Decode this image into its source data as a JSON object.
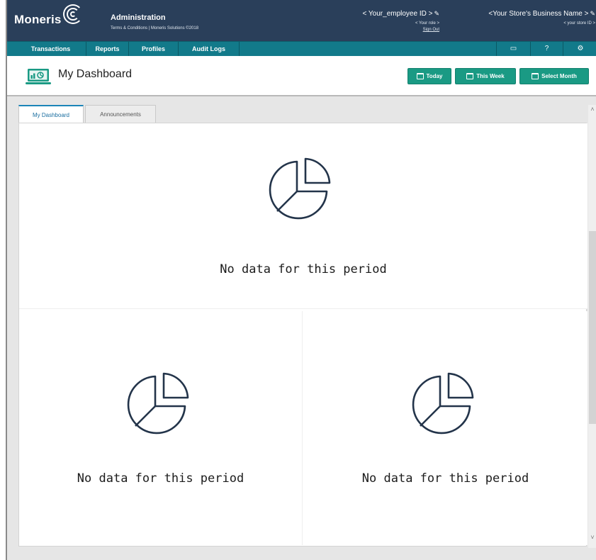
{
  "header": {
    "logo_text": "Moneris",
    "title": "Administration",
    "subtitle": "Terms & Conditions | Moneris Solutions ©2018",
    "employee_id": "< Your_employee ID >",
    "role": "< Your role >",
    "sign_out": "Sign Out",
    "store_name": "<Your Store's Business Name >",
    "store_id": "< your store ID >"
  },
  "nav": {
    "items": [
      "Transactions",
      "Reports",
      "Profiles",
      "Audit Logs"
    ],
    "icons": [
      "card-icon",
      "help-icon",
      "settings-icon"
    ]
  },
  "page": {
    "title": "My Dashboard",
    "buttons": [
      "Today",
      "This Week",
      "Select Month"
    ]
  },
  "tabs": [
    "My Dashboard",
    "Announcements"
  ],
  "cards": [
    {
      "message": "No data for this period",
      "icon": "pie-chart-icon"
    },
    {
      "message": "No data for this period",
      "icon": "pie-chart-icon"
    },
    {
      "message": "No data for this period",
      "icon": "pie-chart-icon"
    }
  ],
  "colors": {
    "header_bg": "#2a3f5a",
    "nav_bg": "#127a8a",
    "button_bg": "#1a9a84",
    "tab_accent": "#1a84b8"
  }
}
